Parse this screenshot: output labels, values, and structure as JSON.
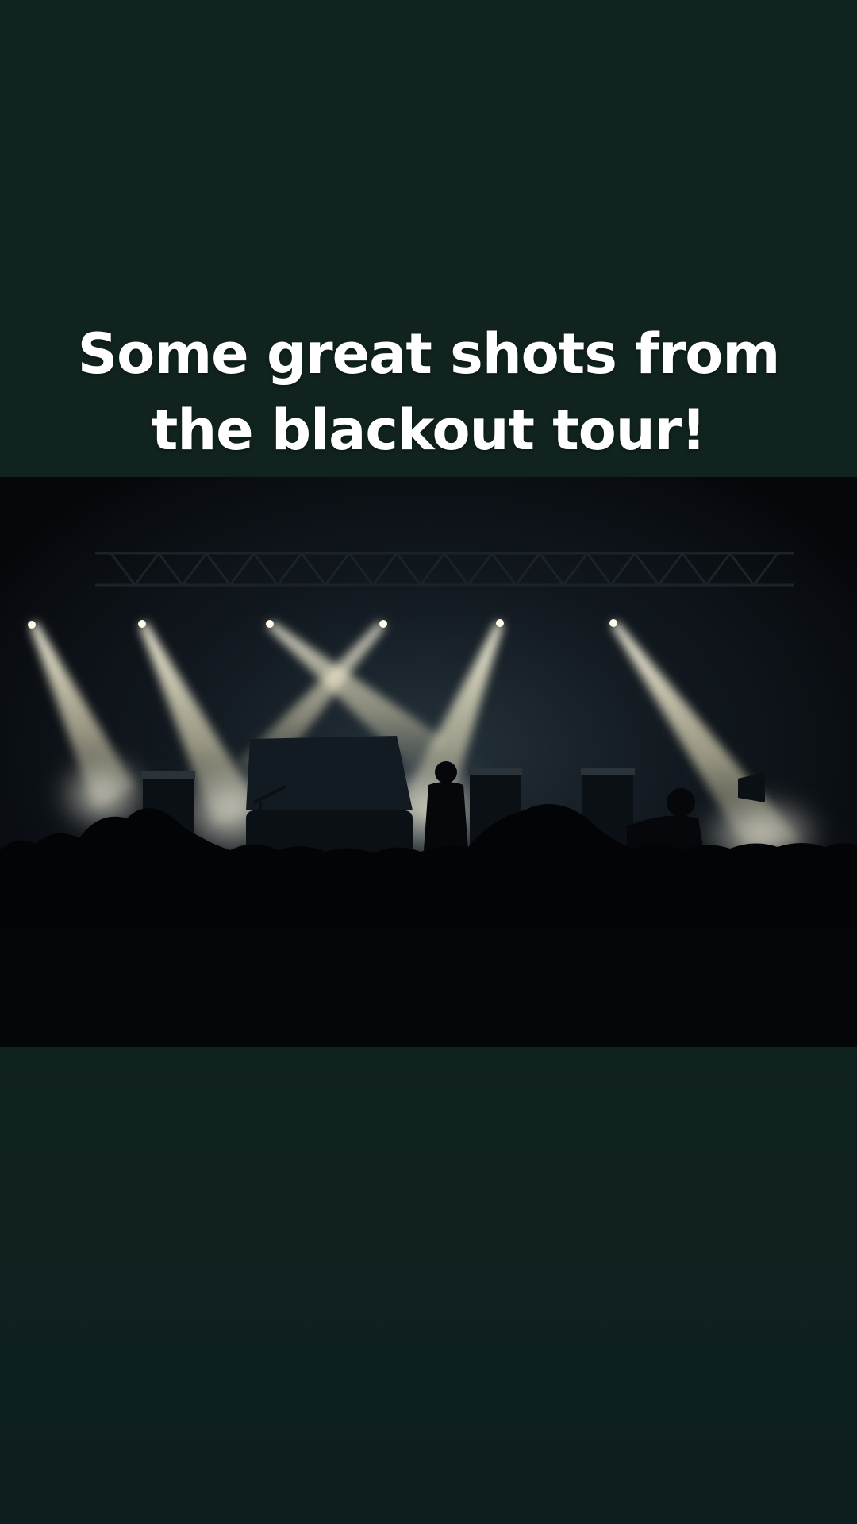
{
  "post": {
    "caption_line1": "Some great shots from",
    "caption_line2": "the blackout tour!"
  },
  "photo": {
    "subject": "concert-stage-photo"
  },
  "colors": {
    "background": "#10231f",
    "caption_text": "#ffffff",
    "light_beam": "#f3eed0"
  }
}
